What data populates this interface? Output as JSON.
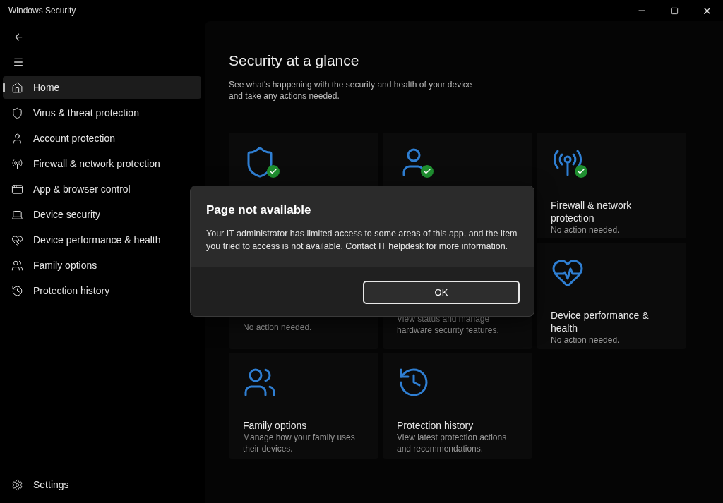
{
  "window": {
    "title": "Windows Security"
  },
  "sidebar": {
    "items": [
      {
        "label": "Home",
        "selected": true
      },
      {
        "label": "Virus & threat protection",
        "selected": false
      },
      {
        "label": "Account protection",
        "selected": false
      },
      {
        "label": "Firewall & network protection",
        "selected": false
      },
      {
        "label": "App & browser control",
        "selected": false
      },
      {
        "label": "Device security",
        "selected": false
      },
      {
        "label": "Device performance & health",
        "selected": false
      },
      {
        "label": "Family options",
        "selected": false
      },
      {
        "label": "Protection history",
        "selected": false
      }
    ],
    "settings": {
      "label": "Settings",
      "selected": false
    }
  },
  "page": {
    "title": "Security at a glance",
    "subtitle": "See what's happening with the security and health of your device and take any actions needed."
  },
  "cards": [
    {
      "ok": true
    },
    {
      "ok": true
    },
    {
      "ok": true,
      "title": "Firewall & network protection",
      "description": "No action needed."
    },
    {
      "description": "No action needed."
    },
    {
      "description": "View status and manage hardware security features."
    },
    {
      "ok": false,
      "title": "Device performance & health",
      "description": "No action needed."
    },
    {
      "ok": false,
      "title": "Family options",
      "description": "Manage how your family uses their devices."
    },
    {
      "ok": false,
      "title": "Protection history",
      "description": "View latest protection actions and recommendations."
    }
  ],
  "dialog": {
    "title": "Page not available",
    "message": "Your IT administrator has limited access to some areas of this app, and the item you tried to access is not available. Contact IT helpdesk for more information.",
    "button": "OK"
  }
}
